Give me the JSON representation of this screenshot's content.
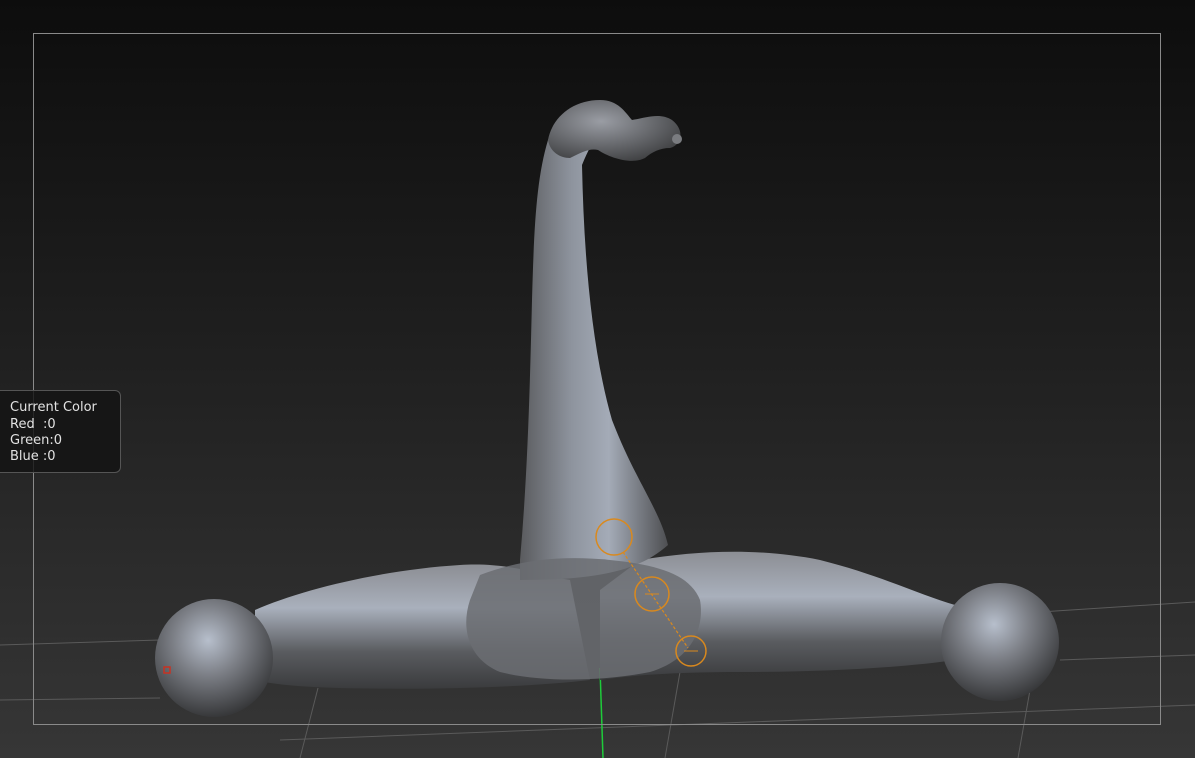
{
  "current_color_panel": {
    "title": "Current Color",
    "red": "Red  :0",
    "green": "Green:0",
    "blue": "Blue :0"
  },
  "colors": {
    "brush_ring": "#d9891e",
    "axis_y": "#1ecb3a",
    "mesh_highlight": "#cdd4df",
    "marker": "#c83222"
  },
  "icons": {
    "brush_cursor": "brush-cursor-icon",
    "pin_marker": "pin-marker-icon"
  }
}
